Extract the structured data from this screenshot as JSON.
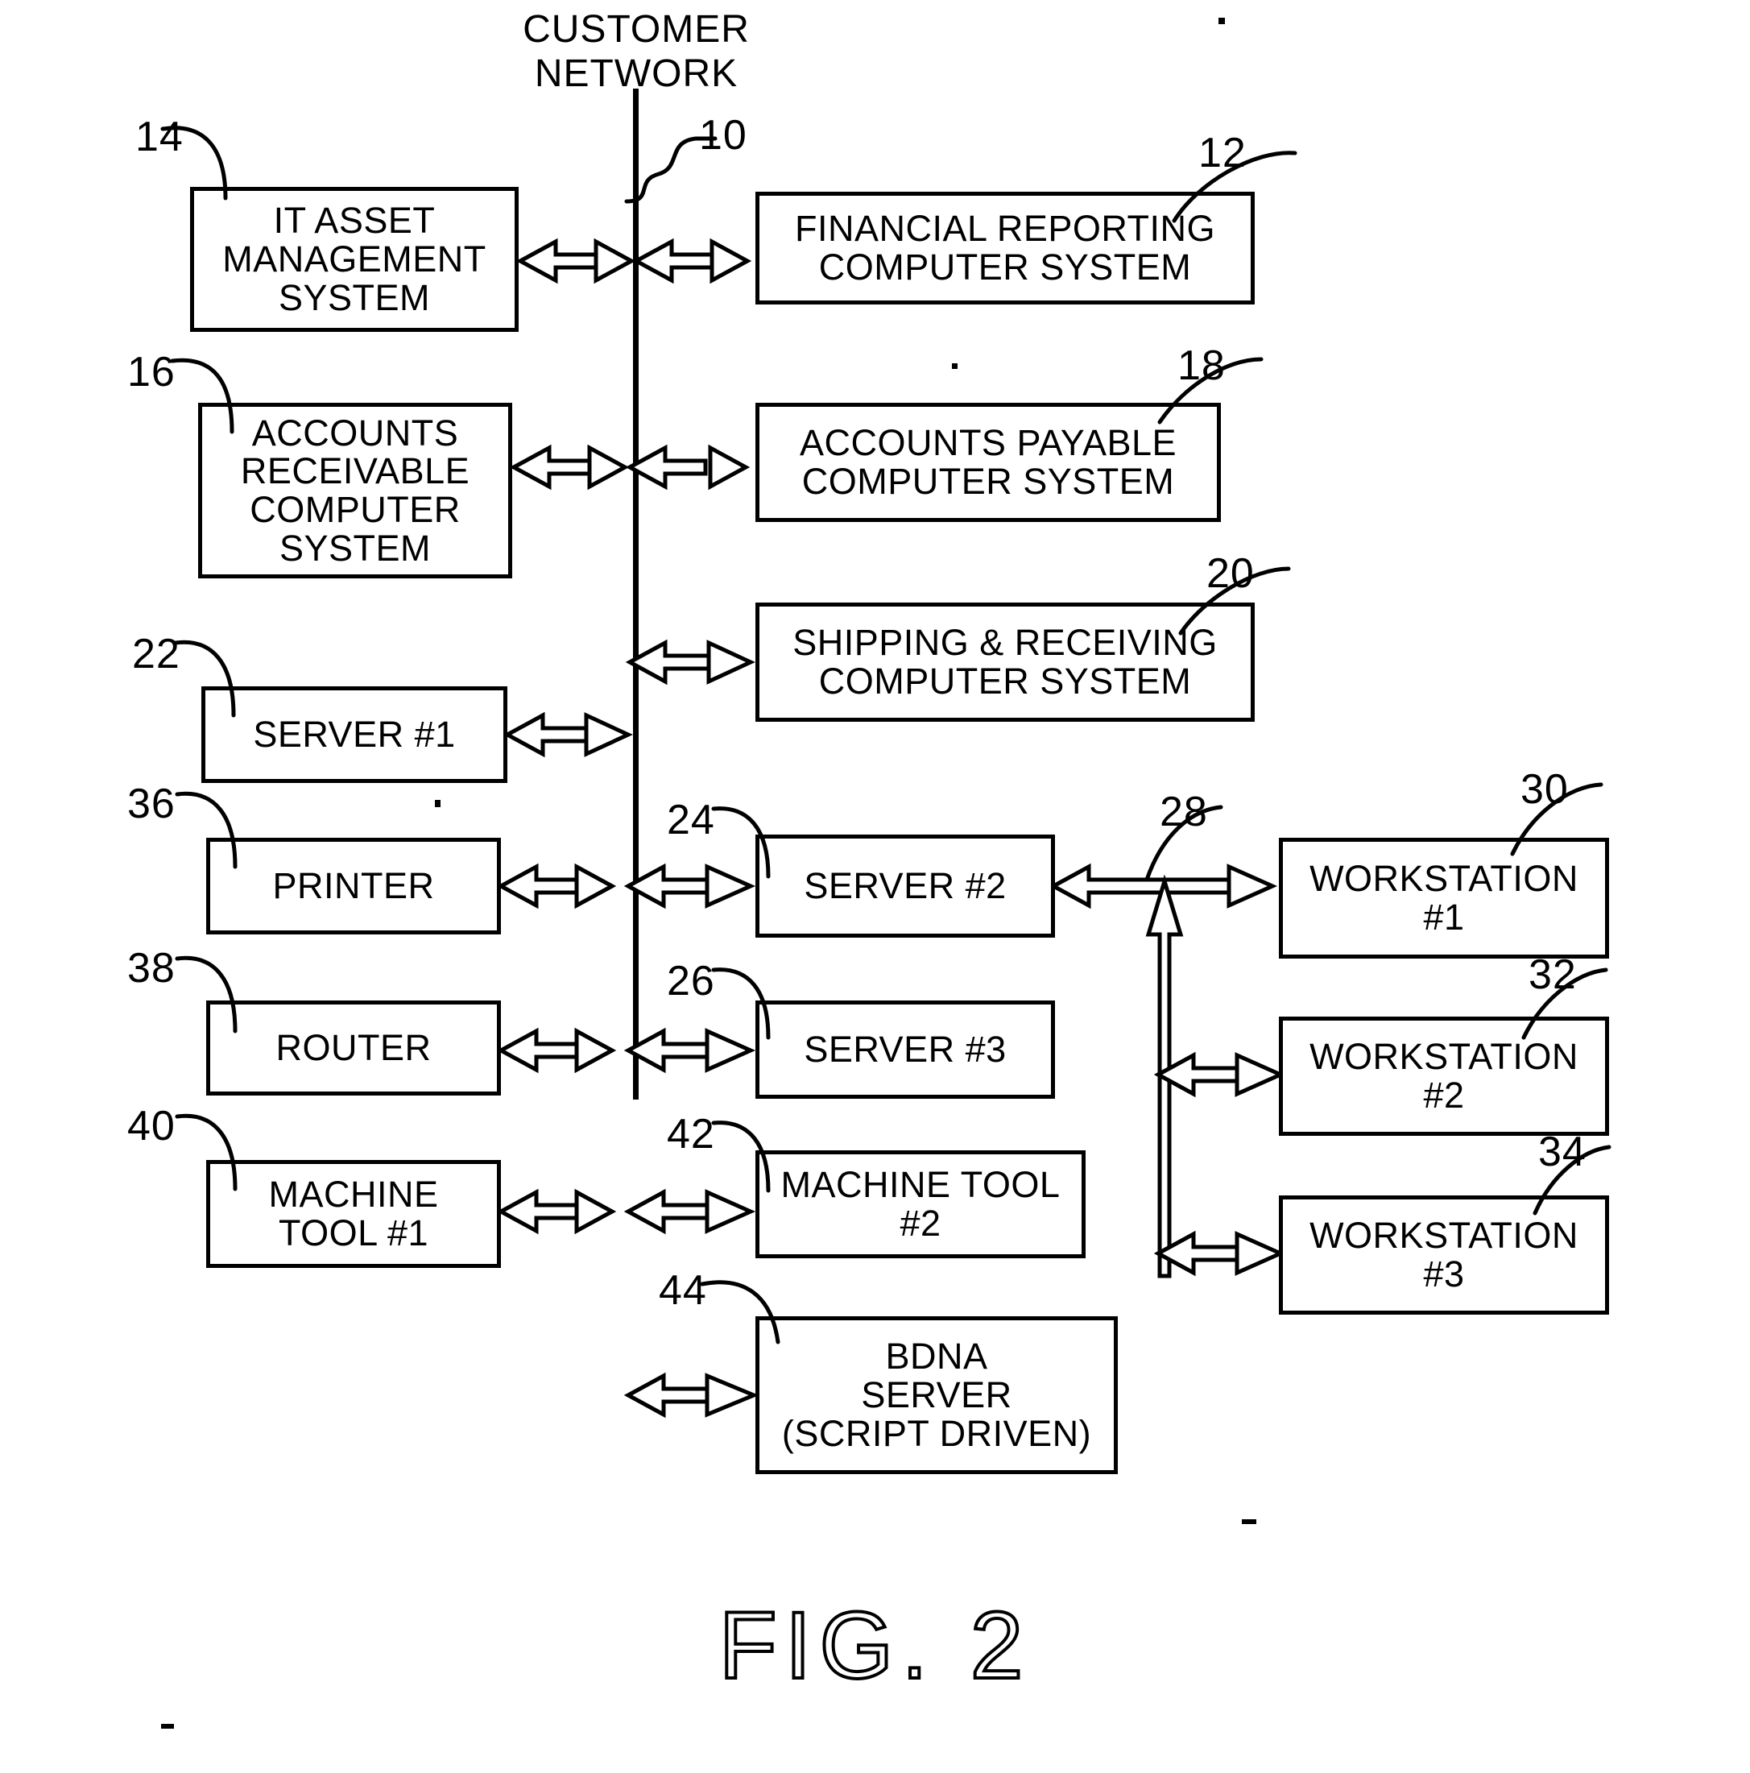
{
  "figure": {
    "caption": "FIG. 2",
    "network_label": "CUSTOMER\nNETWORK",
    "network_ref": "10"
  },
  "nodes": [
    {
      "id": "it-asset-management-system",
      "ref": "14",
      "label": "IT ASSET\nMANAGEMENT\nSYSTEM"
    },
    {
      "id": "financial-reporting-computer-system",
      "ref": "12",
      "label": "FINANCIAL REPORTING\nCOMPUTER SYSTEM"
    },
    {
      "id": "accounts-receivable-computer-system",
      "ref": "16",
      "label": "ACCOUNTS\nRECEIVABLE\nCOMPUTER\nSYSTEM"
    },
    {
      "id": "accounts-payable-computer-system",
      "ref": "18",
      "label": "ACCOUNTS PAYABLE\nCOMPUTER SYSTEM"
    },
    {
      "id": "shipping-receiving-computer-system",
      "ref": "20",
      "label": "SHIPPING & RECEIVING\nCOMPUTER SYSTEM"
    },
    {
      "id": "server-1",
      "ref": "22",
      "label": "SERVER #1"
    },
    {
      "id": "printer",
      "ref": "36",
      "label": "PRINTER"
    },
    {
      "id": "server-2",
      "ref": "24",
      "label": "SERVER #2"
    },
    {
      "id": "workstation-1",
      "ref": "30",
      "label": "WORKSTATION\n#1"
    },
    {
      "id": "router",
      "ref": "38",
      "label": "ROUTER"
    },
    {
      "id": "server-3",
      "ref": "26",
      "label": "SERVER #3"
    },
    {
      "id": "workstation-2",
      "ref": "32",
      "label": "WORKSTATION\n#2"
    },
    {
      "id": "machine-tool-1",
      "ref": "40",
      "label": "MACHINE\nTOOL #1"
    },
    {
      "id": "machine-tool-2",
      "ref": "42",
      "label": "MACHINE TOOL\n#2"
    },
    {
      "id": "workstation-3",
      "ref": "34",
      "label": "WORKSTATION\n#3"
    },
    {
      "id": "bdna-server",
      "ref": "44",
      "label": "BDNA\nSERVER\n(SCRIPT DRIVEN)"
    }
  ],
  "bus_ref": "28",
  "colors": {
    "ink": "#000000",
    "paper": "#ffffff"
  }
}
